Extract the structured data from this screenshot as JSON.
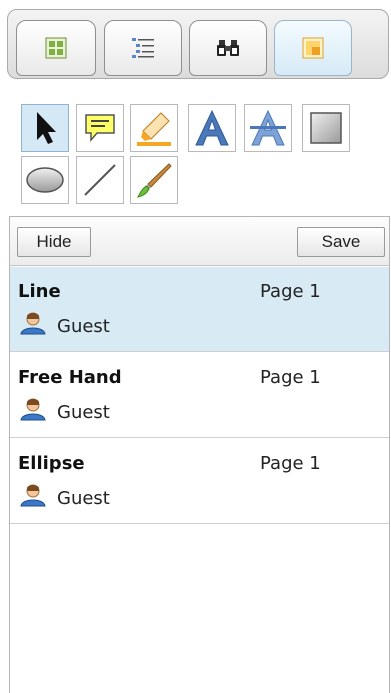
{
  "tabs": [
    {
      "icon": "thumbnails-icon",
      "active": false
    },
    {
      "icon": "outline-list-icon",
      "active": false
    },
    {
      "icon": "binoculars-icon",
      "active": false
    },
    {
      "icon": "annotations-icon",
      "active": true
    }
  ],
  "tools": [
    {
      "icon": "select-arrow-icon",
      "selected": true
    },
    {
      "icon": "sticky-note-icon",
      "selected": false
    },
    {
      "icon": "highlighter-icon",
      "selected": false
    },
    {
      "icon": "text-icon",
      "selected": false
    },
    {
      "icon": "strikethrough-icon",
      "selected": false
    },
    {
      "icon": "rectangle-icon",
      "selected": false
    },
    {
      "icon": "ellipse-icon",
      "selected": false
    },
    {
      "icon": "line-icon",
      "selected": false
    },
    {
      "icon": "freehand-brush-icon",
      "selected": false
    }
  ],
  "panel": {
    "hide_label": "Hide",
    "save_label": "Save"
  },
  "annotations": [
    {
      "type": "Line",
      "page": "Page 1",
      "user": "Guest",
      "selected": true
    },
    {
      "type": "Free Hand",
      "page": "Page 1",
      "user": "Guest",
      "selected": false
    },
    {
      "type": "Ellipse",
      "page": "Page 1",
      "user": "Guest",
      "selected": false
    }
  ],
  "colors": {
    "selected_bg": "#d8ebf5",
    "accent_blue": "#4a78b8",
    "note_yellow": "#ffff66",
    "highlight_orange": "#f5a623"
  }
}
